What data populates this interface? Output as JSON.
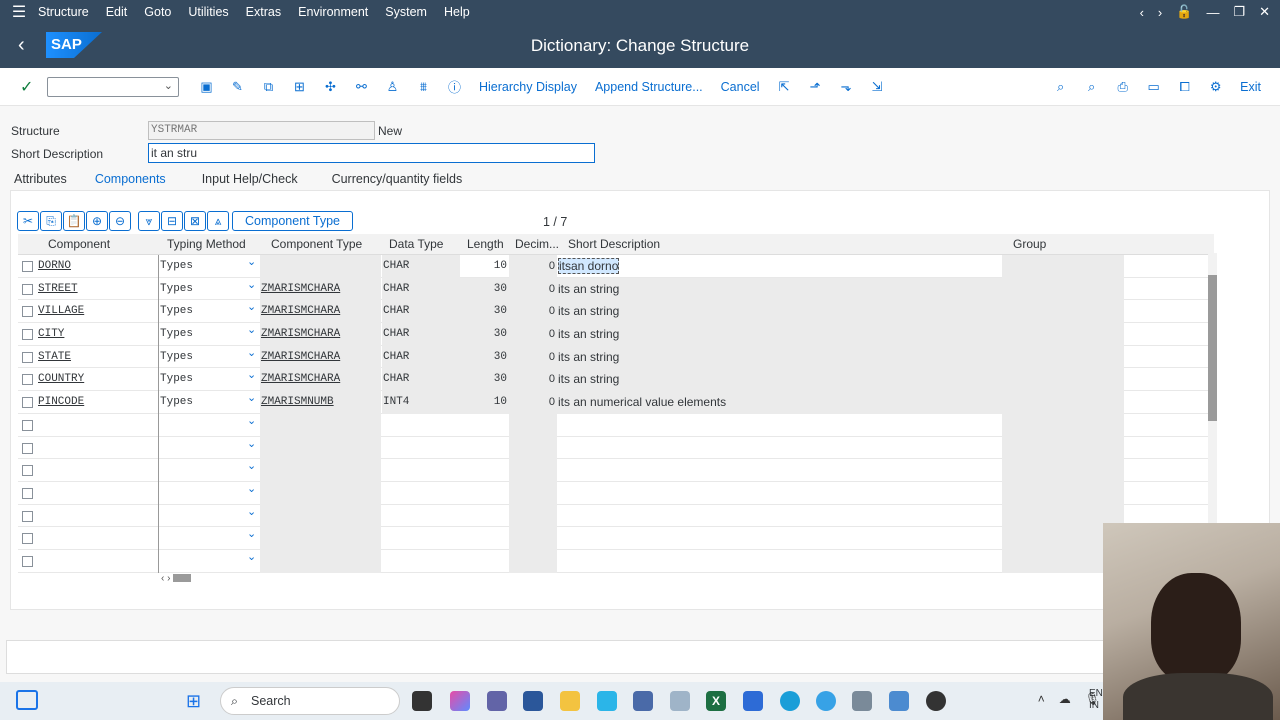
{
  "menu": [
    "Structure",
    "Edit",
    "Goto",
    "Utilities",
    "Extras",
    "Environment",
    "System",
    "Help"
  ],
  "title": "Dictionary: Change Structure",
  "logo": "SAP",
  "toolbar": {
    "hierarchy": "Hierarchy Display",
    "append": "Append Structure...",
    "cancel": "Cancel",
    "exit": "Exit"
  },
  "form": {
    "structure_label": "Structure",
    "structure_value": "YSTRMAR",
    "status": "New",
    "short_desc_label": "Short Description",
    "short_desc_value": "it an stru"
  },
  "tabs": [
    "Attributes",
    "Components",
    "Input Help/Check",
    "Currency/quantity fields"
  ],
  "table": {
    "component_type_btn": "Component Type",
    "counter": "1 / 7",
    "headers": [
      "Component",
      "Typing Method",
      "Component Type",
      "Data Type",
      "Length",
      "Decim...",
      "Short Description",
      "Group"
    ],
    "rows": [
      {
        "component": "DORNO",
        "typing": "Types",
        "ctype": "",
        "dtype": "CHAR",
        "length": "10",
        "dec": "0",
        "desc": "itsan dorno"
      },
      {
        "component": "STREET",
        "typing": "Types",
        "ctype": "ZMARISMCHARA",
        "dtype": "CHAR",
        "length": "30",
        "dec": "0",
        "desc": "its an string"
      },
      {
        "component": "VILLAGE",
        "typing": "Types",
        "ctype": "ZMARISMCHARA",
        "dtype": "CHAR",
        "length": "30",
        "dec": "0",
        "desc": "its an string"
      },
      {
        "component": "CITY",
        "typing": "Types",
        "ctype": "ZMARISMCHARA",
        "dtype": "CHAR",
        "length": "30",
        "dec": "0",
        "desc": "its an string"
      },
      {
        "component": "STATE",
        "typing": "Types",
        "ctype": "ZMARISMCHARA",
        "dtype": "CHAR",
        "length": "30",
        "dec": "0",
        "desc": "its an string"
      },
      {
        "component": "COUNTRY",
        "typing": "Types",
        "ctype": "ZMARISMCHARA",
        "dtype": "CHAR",
        "length": "30",
        "dec": "0",
        "desc": "its an string"
      },
      {
        "component": "PINCODE",
        "typing": "Types",
        "ctype": "ZMARISMNUMB",
        "dtype": "INT4",
        "length": "10",
        "dec": "0",
        "desc": "its an numerical value elements"
      }
    ],
    "empty_rows": 7
  },
  "taskbar": {
    "search": "Search",
    "lang": "EN",
    "region": "IN"
  }
}
